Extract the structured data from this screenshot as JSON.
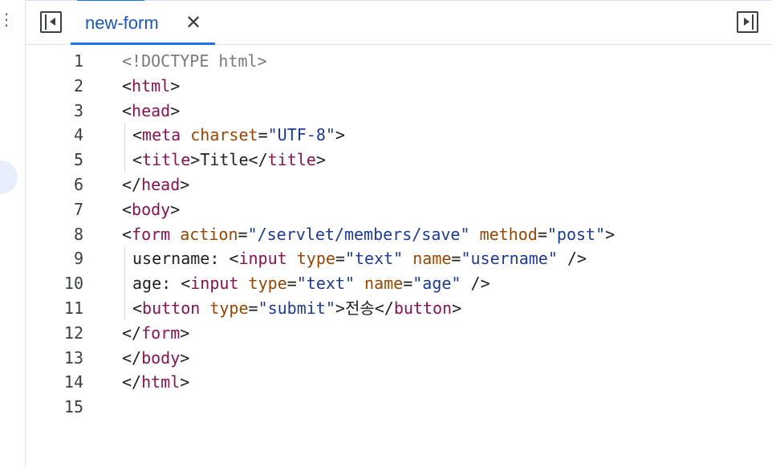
{
  "tab": {
    "label": "new-form",
    "close_glyph": "✕"
  },
  "icons": {
    "left_toggle": "sidebar-collapse-left-icon",
    "right_toggle": "sidebar-collapse-right-icon",
    "left_menu": "more-vertical-icon"
  },
  "left_pane": {
    "menu_glyph": "⋮"
  },
  "colors": {
    "accent": "#1a73e8",
    "tag": "#881350",
    "attribute": "#994500",
    "value": "#1a3a9c",
    "doctype": "#7a7a7a"
  },
  "code": {
    "lines": [
      {
        "n": "1",
        "indent": false,
        "tokens": [
          {
            "t": "<!DOCTYPE html>",
            "c": "doc"
          }
        ]
      },
      {
        "n": "2",
        "indent": false,
        "tokens": [
          {
            "t": "<",
            "c": "pun"
          },
          {
            "t": "html",
            "c": "tag"
          },
          {
            "t": ">",
            "c": "pun"
          }
        ]
      },
      {
        "n": "3",
        "indent": false,
        "tokens": [
          {
            "t": "<",
            "c": "pun"
          },
          {
            "t": "head",
            "c": "tag"
          },
          {
            "t": ">",
            "c": "pun"
          }
        ]
      },
      {
        "n": "4",
        "indent": true,
        "tokens": [
          {
            "t": "<",
            "c": "pun"
          },
          {
            "t": "meta",
            "c": "tag"
          },
          {
            "t": " ",
            "c": "pun"
          },
          {
            "t": "charset",
            "c": "att"
          },
          {
            "t": "=",
            "c": "pun"
          },
          {
            "t": "\"UTF-8\"",
            "c": "val"
          },
          {
            "t": ">",
            "c": "pun"
          }
        ]
      },
      {
        "n": "5",
        "indent": true,
        "tokens": [
          {
            "t": "<",
            "c": "pun"
          },
          {
            "t": "title",
            "c": "tag"
          },
          {
            "t": ">",
            "c": "pun"
          },
          {
            "t": "Title",
            "c": "txt"
          },
          {
            "t": "</",
            "c": "pun"
          },
          {
            "t": "title",
            "c": "tag"
          },
          {
            "t": ">",
            "c": "pun"
          }
        ]
      },
      {
        "n": "6",
        "indent": false,
        "tokens": [
          {
            "t": "</",
            "c": "pun"
          },
          {
            "t": "head",
            "c": "tag"
          },
          {
            "t": ">",
            "c": "pun"
          }
        ]
      },
      {
        "n": "7",
        "indent": false,
        "tokens": [
          {
            "t": "<",
            "c": "pun"
          },
          {
            "t": "body",
            "c": "tag"
          },
          {
            "t": ">",
            "c": "pun"
          }
        ]
      },
      {
        "n": "8",
        "indent": false,
        "tokens": [
          {
            "t": "<",
            "c": "pun"
          },
          {
            "t": "form",
            "c": "tag"
          },
          {
            "t": " ",
            "c": "pun"
          },
          {
            "t": "action",
            "c": "att"
          },
          {
            "t": "=",
            "c": "pun"
          },
          {
            "t": "\"/servlet/members/save\"",
            "c": "val"
          },
          {
            "t": " ",
            "c": "pun"
          },
          {
            "t": "method",
            "c": "att"
          },
          {
            "t": "=",
            "c": "pun"
          },
          {
            "t": "\"post\"",
            "c": "val"
          },
          {
            "t": ">",
            "c": "pun"
          }
        ]
      },
      {
        "n": "9",
        "indent": true,
        "tokens": [
          {
            "t": "username: ",
            "c": "txt"
          },
          {
            "t": "<",
            "c": "pun"
          },
          {
            "t": "input",
            "c": "tag"
          },
          {
            "t": " ",
            "c": "pun"
          },
          {
            "t": "type",
            "c": "att"
          },
          {
            "t": "=",
            "c": "pun"
          },
          {
            "t": "\"text\"",
            "c": "val"
          },
          {
            "t": " ",
            "c": "pun"
          },
          {
            "t": "name",
            "c": "att"
          },
          {
            "t": "=",
            "c": "pun"
          },
          {
            "t": "\"username\"",
            "c": "val"
          },
          {
            "t": " />",
            "c": "pun"
          }
        ]
      },
      {
        "n": "10",
        "indent": true,
        "tokens": [
          {
            "t": "age: ",
            "c": "txt"
          },
          {
            "t": "<",
            "c": "pun"
          },
          {
            "t": "input",
            "c": "tag"
          },
          {
            "t": " ",
            "c": "pun"
          },
          {
            "t": "type",
            "c": "att"
          },
          {
            "t": "=",
            "c": "pun"
          },
          {
            "t": "\"text\"",
            "c": "val"
          },
          {
            "t": " ",
            "c": "pun"
          },
          {
            "t": "name",
            "c": "att"
          },
          {
            "t": "=",
            "c": "pun"
          },
          {
            "t": "\"age\"",
            "c": "val"
          },
          {
            "t": " />",
            "c": "pun"
          }
        ]
      },
      {
        "n": "11",
        "indent": true,
        "tokens": [
          {
            "t": "<",
            "c": "pun"
          },
          {
            "t": "button",
            "c": "tag"
          },
          {
            "t": " ",
            "c": "pun"
          },
          {
            "t": "type",
            "c": "att"
          },
          {
            "t": "=",
            "c": "pun"
          },
          {
            "t": "\"submit\"",
            "c": "val"
          },
          {
            "t": ">",
            "c": "pun"
          },
          {
            "t": "전송",
            "c": "txt"
          },
          {
            "t": "</",
            "c": "pun"
          },
          {
            "t": "button",
            "c": "tag"
          },
          {
            "t": ">",
            "c": "pun"
          }
        ]
      },
      {
        "n": "12",
        "indent": false,
        "tokens": [
          {
            "t": "</",
            "c": "pun"
          },
          {
            "t": "form",
            "c": "tag"
          },
          {
            "t": ">",
            "c": "pun"
          }
        ]
      },
      {
        "n": "13",
        "indent": false,
        "tokens": [
          {
            "t": "</",
            "c": "pun"
          },
          {
            "t": "body",
            "c": "tag"
          },
          {
            "t": ">",
            "c": "pun"
          }
        ]
      },
      {
        "n": "14",
        "indent": false,
        "tokens": [
          {
            "t": "</",
            "c": "pun"
          },
          {
            "t": "html",
            "c": "tag"
          },
          {
            "t": ">",
            "c": "pun"
          }
        ]
      },
      {
        "n": "15",
        "indent": false,
        "tokens": []
      }
    ]
  }
}
